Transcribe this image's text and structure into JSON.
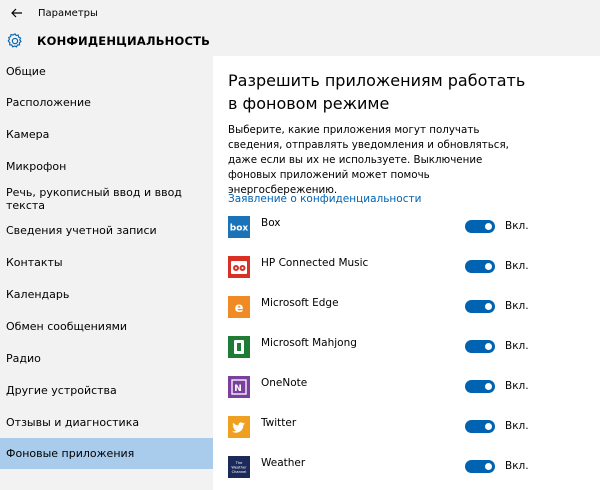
{
  "window": {
    "title": "Параметры"
  },
  "header": {
    "section_title": "КОНФИДЕНЦИАЛЬНОСТЬ"
  },
  "sidebar": {
    "items": [
      {
        "label": "Общие"
      },
      {
        "label": "Расположение"
      },
      {
        "label": "Камера"
      },
      {
        "label": "Микрофон"
      },
      {
        "label": "Речь, рукописный ввод и ввод текста"
      },
      {
        "label": "Сведения учетной записи"
      },
      {
        "label": "Контакты"
      },
      {
        "label": "Календарь"
      },
      {
        "label": "Обмен сообщениями"
      },
      {
        "label": "Радио"
      },
      {
        "label": "Другие устройства"
      },
      {
        "label": "Отзывы и диагностика"
      },
      {
        "label": "Фоновые приложения",
        "selected": true
      }
    ]
  },
  "main": {
    "heading": "Разрешить приложениям работать в фоновом режиме",
    "description": "Выберите, какие приложения могут получать сведения, отправлять уведомления и обновляться, даже если вы их не используете. Выключение фоновых приложений может помочь энергосбережению.",
    "privacy_link": "Заявление о конфиденциальности",
    "apps": [
      {
        "name": "Box",
        "icon": "box-icon",
        "color": "#1a73b8",
        "toggle_label": "Вкл.",
        "on": true
      },
      {
        "name": "HP Connected Music",
        "icon": "hp-connected-music-icon",
        "color": "#d93025",
        "toggle_label": "Вкл.",
        "on": true
      },
      {
        "name": "Microsoft Edge",
        "icon": "edge-icon",
        "color": "#f08a24",
        "toggle_label": "Вкл.",
        "on": true
      },
      {
        "name": "Microsoft Mahjong",
        "icon": "mahjong-icon",
        "color": "#1e7c34",
        "toggle_label": "Вкл.",
        "on": true
      },
      {
        "name": "OneNote",
        "icon": "onenote-icon",
        "color": "#7b3fa0",
        "toggle_label": "Вкл.",
        "on": true
      },
      {
        "name": "Twitter",
        "icon": "twitter-icon",
        "color": "#f0a020",
        "toggle_label": "Вкл.",
        "on": true
      },
      {
        "name": "Weather",
        "icon": "weather-channel-icon",
        "color": "#1c2a5a",
        "toggle_label": "Вкл.",
        "on": true,
        "icon_text": "The Weather Channel"
      }
    ]
  },
  "colors": {
    "accent": "#0063b1",
    "sidebar_bg": "#f2f2f2",
    "selected_bg": "#a9ccec"
  }
}
